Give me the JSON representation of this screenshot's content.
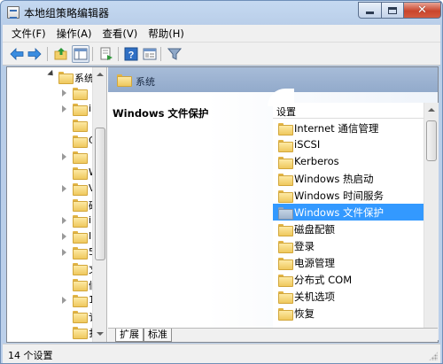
{
  "window": {
    "title": "本地组策略编辑器"
  },
  "menu": [
    {
      "label": "文件(F)"
    },
    {
      "label": "操作(A)"
    },
    {
      "label": "查看(V)"
    },
    {
      "label": "帮助(H)"
    }
  ],
  "toolbar": {
    "icons": [
      "back-arrow-icon",
      "forward-arrow-icon",
      "up-folder-icon",
      "show-hide-tree-icon",
      "export-list-icon",
      "help-icon",
      "properties-icon",
      "filter-icon"
    ]
  },
  "tree": {
    "items": [
      {
        "label": "系统",
        "expanded": true
      },
      {
        "label": ""
      },
      {
        "label": "i"
      },
      {
        "label": ""
      },
      {
        "label": "C"
      },
      {
        "label": ""
      },
      {
        "label": "W"
      },
      {
        "label": "V"
      },
      {
        "label": "码"
      },
      {
        "label": "i"
      },
      {
        "label": "I"
      },
      {
        "label": "5"
      },
      {
        "label": "文"
      },
      {
        "label": "们"
      },
      {
        "label": "1"
      },
      {
        "label": "讠"
      },
      {
        "label": "扌"
      }
    ]
  },
  "right_pane": {
    "header": "系统",
    "description_title": "Windows 文件保护",
    "list_header": "设置",
    "items": [
      {
        "label": "Internet 通信管理"
      },
      {
        "label": "iSCSI"
      },
      {
        "label": "Kerberos"
      },
      {
        "label": "Windows 热启动"
      },
      {
        "label": "Windows 时间服务"
      },
      {
        "label": "Windows 文件保护",
        "selected": true
      },
      {
        "label": "磁盘配额"
      },
      {
        "label": "登录"
      },
      {
        "label": "电源管理"
      },
      {
        "label": "分布式 COM"
      },
      {
        "label": "关机选项"
      },
      {
        "label": "恢复"
      }
    ]
  },
  "tabs": [
    {
      "label": "扩展",
      "active": true
    },
    {
      "label": "标准",
      "active": false
    }
  ],
  "status": {
    "text": "14 个设置"
  },
  "colors": {
    "selection": "#3399ff",
    "header_band": "#9fb5d3",
    "chrome": "#f0f0f0"
  }
}
